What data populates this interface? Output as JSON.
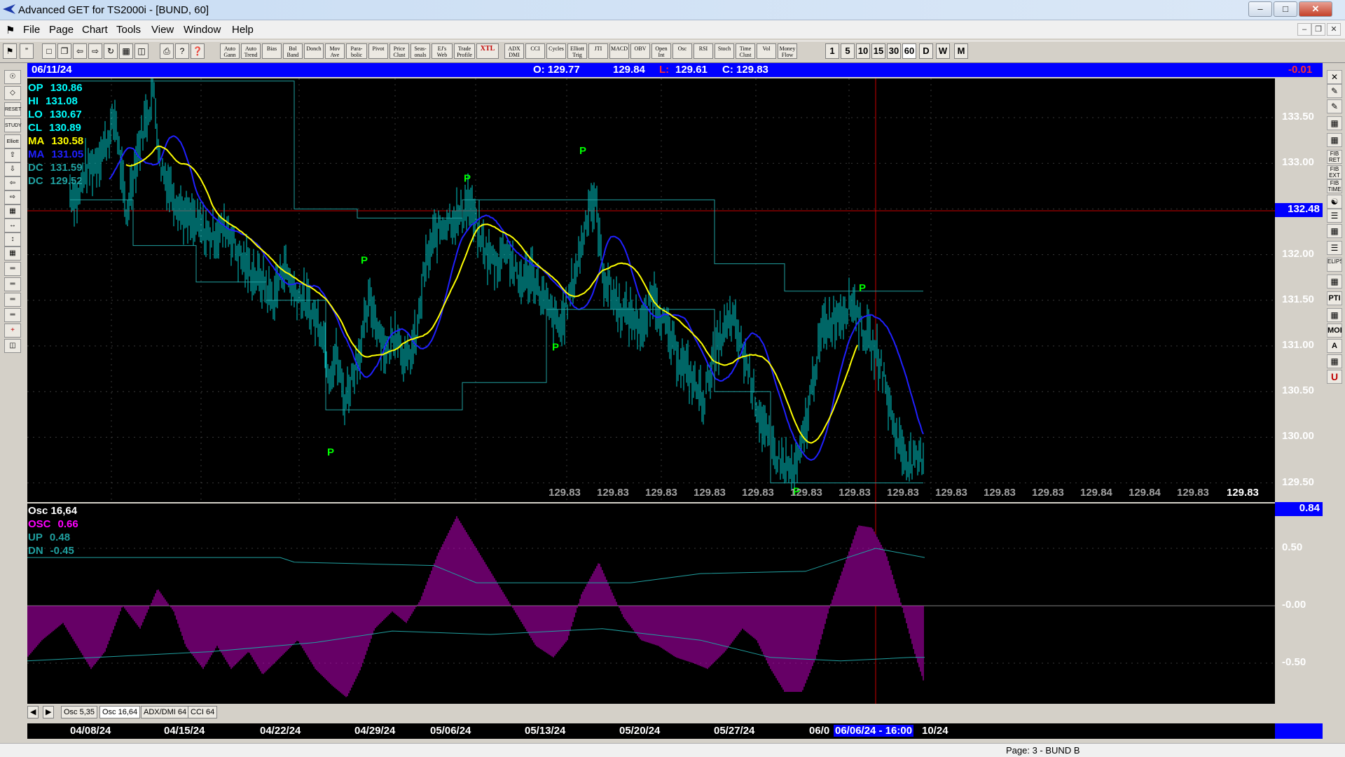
{
  "window": {
    "title": "Advanced GET for TS2000i - [BUND, 60]"
  },
  "menu": [
    "File",
    "Page",
    "Chart",
    "Tools",
    "View",
    "Window",
    "Help"
  ],
  "toolbar": {
    "studies": [
      "Auto Gann",
      "Auto Trend",
      "Bias",
      "Bol Band",
      "Donch",
      "Mov Ave",
      "Para-bolic",
      "Pivot",
      "Price Clust",
      "Seas-onals",
      "EJ's Web",
      "Trade Profile",
      "XTL",
      "ADX DMI",
      "CCI",
      "Cycles",
      "Elliott Trig",
      "JTI",
      "MACD",
      "OBV",
      "Open Int",
      "Osc",
      "RSI",
      "Stoch",
      "Time Clust",
      "Vol",
      "Money Flow"
    ],
    "intervals": [
      "1",
      "5",
      "10",
      "15",
      "30",
      "60",
      "D",
      "W",
      "M"
    ]
  },
  "left_tools": [
    "RESET",
    "STUDY",
    "Elliott"
  ],
  "right_tools": [
    "FIB RET",
    "FIB EXT",
    "FIB TIME",
    "ELIPS",
    "PTI",
    "MOB",
    "A",
    "U"
  ],
  "header": {
    "date": "06/11/24",
    "open": "O: 129.77",
    "high": "129.84",
    "low_label": "L:",
    "low": "129.61",
    "close": "C: 129.83",
    "change": "-0.01"
  },
  "legend_main": [
    {
      "label": "OP",
      "value": "130.86",
      "color": "#00ffff"
    },
    {
      "label": "HI",
      "value": "131.08",
      "color": "#00ffff"
    },
    {
      "label": "LO",
      "value": "130.67",
      "color": "#00ffff"
    },
    {
      "label": "CL",
      "value": "130.89",
      "color": "#00ffff"
    },
    {
      "label": "MA",
      "value": "130.58",
      "color": "#ffff00"
    },
    {
      "label": "MA",
      "value": "131.05",
      "color": "#2020ff"
    },
    {
      "label": "DC",
      "value": "131.59",
      "color": "#20a0a0"
    },
    {
      "label": "DC",
      "value": "129.52",
      "color": "#20a0a0"
    }
  ],
  "price_axis": [
    "133.50",
    "133.00",
    "132.50",
    "132.00",
    "131.50",
    "131.00",
    "130.50",
    "130.00",
    "129.50"
  ],
  "price_cursor": "132.48",
  "bottom_prices": [
    "129.83",
    "129.83",
    "129.83",
    "129.83",
    "129.83",
    "129.83",
    "129.83",
    "129.83",
    "129.83",
    "129.83",
    "129.83",
    "129.84",
    "129.84",
    "129.83"
  ],
  "last_price": "129.83",
  "pivot_marker": "P",
  "legend_osc": [
    {
      "label": "Osc 16,64",
      "value": "",
      "color": "#ffffff"
    },
    {
      "label": "OSC",
      "value": "0.66",
      "color": "#ff00ff"
    },
    {
      "label": "UP",
      "value": "0.48",
      "color": "#20a0a0"
    },
    {
      "label": "DN",
      "value": "-0.45",
      "color": "#20a0a0"
    }
  ],
  "osc_axis": [
    "0.50",
    "-0.00",
    "-0.50"
  ],
  "osc_cursor": "0.84",
  "tabs": [
    "Osc 5,35",
    "Osc 16,64",
    "ADX/DMI 64",
    "CCI 64"
  ],
  "dates": [
    "04/08/24",
    "04/15/24",
    "04/22/24",
    "04/29/24",
    "05/06/24",
    "05/13/24",
    "05/20/24",
    "05/27/24",
    "06/0",
    "06/06/24 - 16:00",
    "10/24"
  ],
  "status": "Page: 3 - BUND B",
  "colors": {
    "bar": "#00cccc",
    "ma_fast": "#ffff00",
    "ma_slow": "#2020ff",
    "donchian": "#20a0a0",
    "osc": "#cc00cc",
    "pivot": "#00ff00",
    "cursor": "#cc0000",
    "header": "#0000ff"
  }
}
